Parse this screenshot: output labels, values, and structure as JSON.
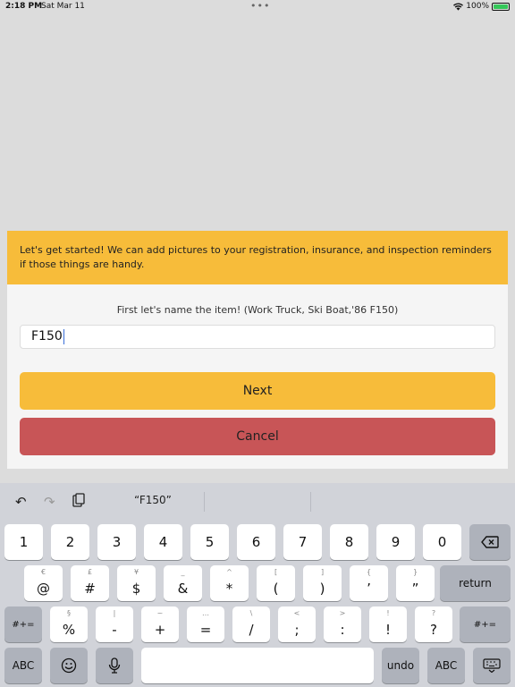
{
  "status": {
    "time": "2:18 PM",
    "date": "Sat Mar 11",
    "dots": "•••",
    "battery": "100%"
  },
  "dialog": {
    "header_text": "Let's get started! We can add pictures to your registration, insurance, and inspection reminders if those things are handy.",
    "prompt": "First let's name the item! (Work Truck, Ski Boat,'86 F150)",
    "input_value": "F150",
    "next_label": "Next",
    "cancel_label": "Cancel"
  },
  "keyboard": {
    "suggestion": "“F150”",
    "row1": [
      "1",
      "2",
      "3",
      "4",
      "5",
      "6",
      "7",
      "8",
      "9",
      "0"
    ],
    "row2": [
      {
        "main": "@",
        "sub": "€"
      },
      {
        "main": "#",
        "sub": "£"
      },
      {
        "main": "$",
        "sub": "¥"
      },
      {
        "main": "&",
        "sub": "_"
      },
      {
        "main": "*",
        "sub": "^"
      },
      {
        "main": "(",
        "sub": "["
      },
      {
        "main": ")",
        "sub": "]"
      },
      {
        "main": "’",
        "sub": "{"
      },
      {
        "main": "”",
        "sub": "}"
      }
    ],
    "row3": [
      {
        "main": "%",
        "sub": "§"
      },
      {
        "main": "-",
        "sub": "|"
      },
      {
        "main": "+",
        "sub": "~"
      },
      {
        "main": "=",
        "sub": "…"
      },
      {
        "main": "/",
        "sub": "\\"
      },
      {
        "main": ";",
        "sub": "<"
      },
      {
        "main": ":",
        "sub": ">"
      },
      {
        "main": "!",
        "sub": "!"
      },
      {
        "main": "?",
        "sub": "?"
      }
    ],
    "return_label": "return",
    "symbols_label": "#+=",
    "abc_label": "ABC",
    "undo_label": "undo"
  }
}
